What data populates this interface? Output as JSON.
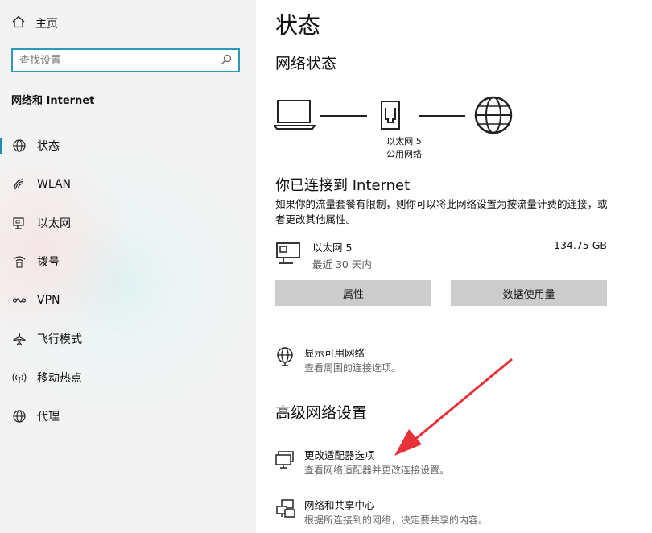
{
  "sidebar": {
    "home_label": "主页",
    "search_placeholder": "查找设置",
    "section_title": "网络和 Internet",
    "items": [
      {
        "label": "状态",
        "icon": "globe-status-icon"
      },
      {
        "label": "WLAN",
        "icon": "wifi-icon"
      },
      {
        "label": "以太网",
        "icon": "ethernet-icon"
      },
      {
        "label": "拨号",
        "icon": "dialup-icon"
      },
      {
        "label": "VPN",
        "icon": "vpn-icon"
      },
      {
        "label": "飞行模式",
        "icon": "airplane-icon"
      },
      {
        "label": "移动热点",
        "icon": "hotspot-icon"
      },
      {
        "label": "代理",
        "icon": "globe-icon"
      }
    ],
    "active_index": 0
  },
  "main": {
    "title": "状态",
    "network_status_heading": "网络状态",
    "diagram": {
      "adapter_name": "以太网 5",
      "network_type": "公用网络"
    },
    "connected_title": "你已连接到 Internet",
    "connected_desc": "如果你的流量套餐有限制，则你可以将此网络设置为按流量计费的连接，或者更改其他属性。",
    "connection": {
      "name": "以太网 5",
      "period": "最近 30 天内",
      "usage": "134.75 GB"
    },
    "buttons": {
      "properties": "属性",
      "data_usage": "数据使用量"
    },
    "show_networks": {
      "title": "显示可用网络",
      "desc": "查看周围的连接选项。"
    },
    "advanced_heading": "高级网络设置",
    "change_adapter": {
      "title": "更改适配器选项",
      "desc": "查看网络适配器并更改连接设置。"
    },
    "sharing_center": {
      "title": "网络和共享中心",
      "desc": "根据所连接到的网络，决定要共享的内容。"
    }
  },
  "colors": {
    "accent": "#1a8fb3",
    "search_border": "#2a9bb8",
    "button_bg": "#cccccc",
    "arrow": "#e8323a"
  }
}
